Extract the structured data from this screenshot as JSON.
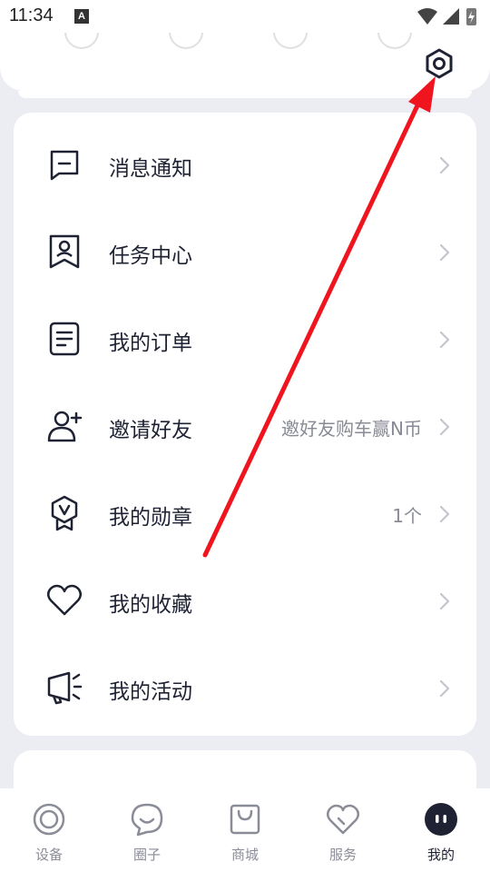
{
  "status": {
    "time": "11:34",
    "notif_badge": "A"
  },
  "header": {
    "ghost_items": [
      "",
      "",
      "",
      ""
    ]
  },
  "menu": {
    "items": [
      {
        "id": "messages",
        "label": "消息通知",
        "sub": "",
        "icon": "chat-bubble-icon"
      },
      {
        "id": "tasks",
        "label": "任务中心",
        "sub": "",
        "icon": "task-badge-icon"
      },
      {
        "id": "orders",
        "label": "我的订单",
        "sub": "",
        "icon": "document-icon"
      },
      {
        "id": "invite",
        "label": "邀请好友",
        "sub": "邀好友购车赢N币",
        "icon": "add-user-icon"
      },
      {
        "id": "medals",
        "label": "我的勋章",
        "sub": "1个",
        "icon": "medal-icon"
      },
      {
        "id": "favorites",
        "label": "我的收藏",
        "sub": "",
        "icon": "heart-icon"
      },
      {
        "id": "activities",
        "label": "我的活动",
        "sub": "",
        "icon": "megaphone-icon"
      }
    ]
  },
  "tabbar": {
    "tabs": [
      {
        "label": "设备",
        "icon": "device-ring-icon",
        "active": false
      },
      {
        "label": "圈子",
        "icon": "chat-smile-icon",
        "active": false
      },
      {
        "label": "商城",
        "icon": "shopping-bag-icon",
        "active": false
      },
      {
        "label": "服务",
        "icon": "heart-service-icon",
        "active": false
      },
      {
        "label": "我的",
        "icon": "profile-face-icon",
        "active": true
      }
    ]
  },
  "colors": {
    "accent": "#1e2233",
    "annotation_arrow": "#f0141e",
    "background": "#ecedf2"
  }
}
